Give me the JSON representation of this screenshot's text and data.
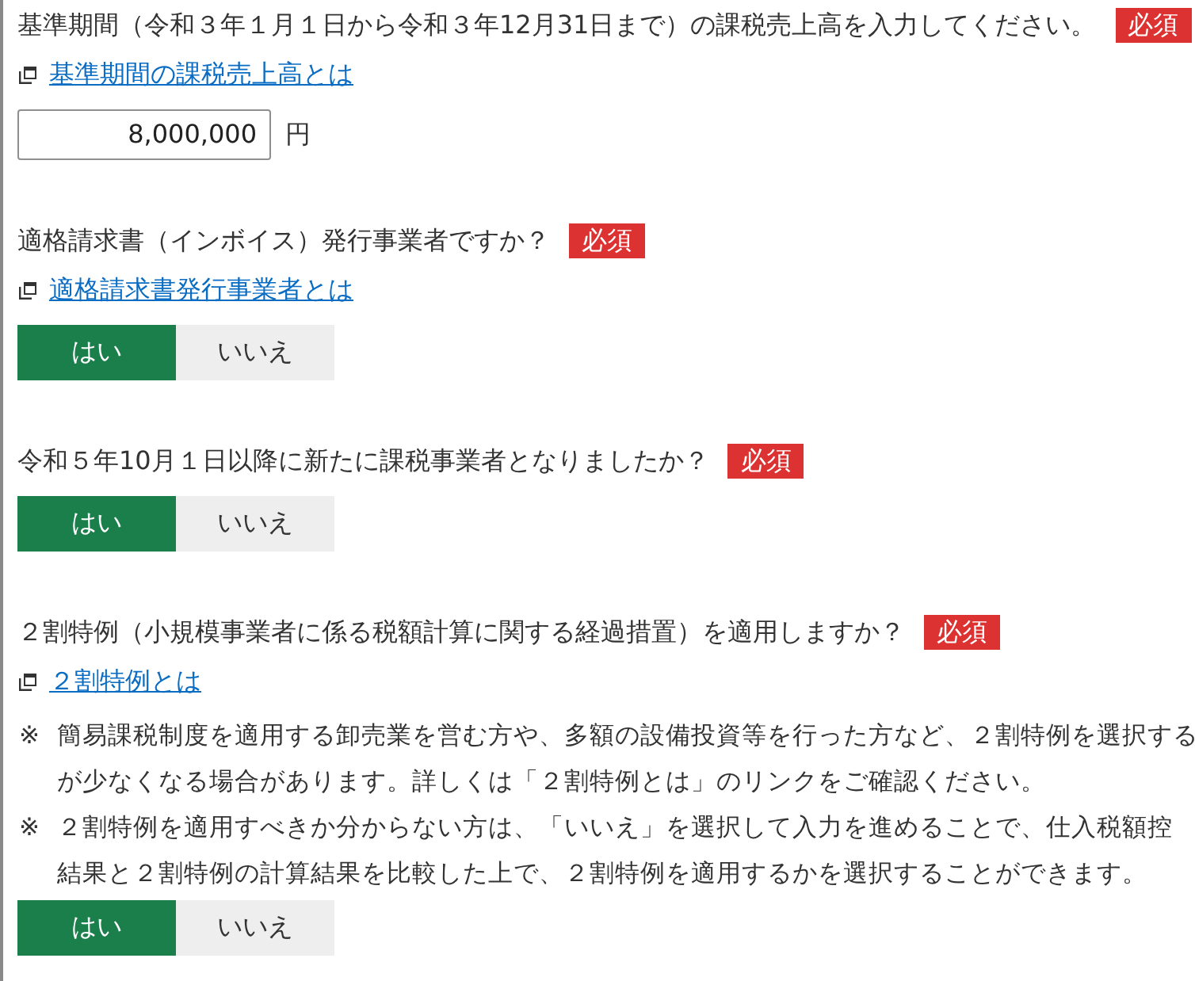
{
  "questions": [
    {
      "kind": "amount",
      "title": "基準期間（令和３年１月１日から令和３年12月31日まで）の課税売上高を入力してください。",
      "badge": "必須",
      "link": "基準期間の課税売上高とは",
      "amount": {
        "value": "8,000,000",
        "unit": "円"
      }
    },
    {
      "kind": "choice",
      "title": "適格請求書（インボイス）発行事業者ですか？",
      "badge": "必須",
      "link": "適格請求書発行事業者とは",
      "options": [
        {
          "label": "はい",
          "selected": true
        },
        {
          "label": "いいえ",
          "selected": false
        }
      ]
    },
    {
      "kind": "choice",
      "title": "令和５年10月１日以降に新たに課税事業者となりましたか？",
      "badge": "必須",
      "options": [
        {
          "label": "はい",
          "selected": true
        },
        {
          "label": "いいえ",
          "selected": false
        }
      ]
    },
    {
      "kind": "choice",
      "title": "２割特例（小規模事業者に係る税額計算に関する経過措置）を適用しますか？",
      "badge": "必須",
      "link": "２割特例とは",
      "notes": [
        {
          "mark": "※",
          "lines": [
            "簡易課税制度を適用する卸売業を営む方や、多額の設備投資等を行った方など、２割特例を選択する",
            "が少なくなる場合があります。詳しくは「２割特例とは」のリンクをご確認ください。"
          ]
        },
        {
          "mark": "※",
          "lines": [
            "２割特例を適用すべきか分からない方は、「いいえ」を選択して入力を進めることで、仕入税額控",
            "結果と２割特例の計算結果を比較した上で、２割特例を適用するかを選択することができます。"
          ]
        }
      ],
      "options": [
        {
          "label": "はい",
          "selected": true
        },
        {
          "label": "いいえ",
          "selected": false
        }
      ]
    }
  ]
}
